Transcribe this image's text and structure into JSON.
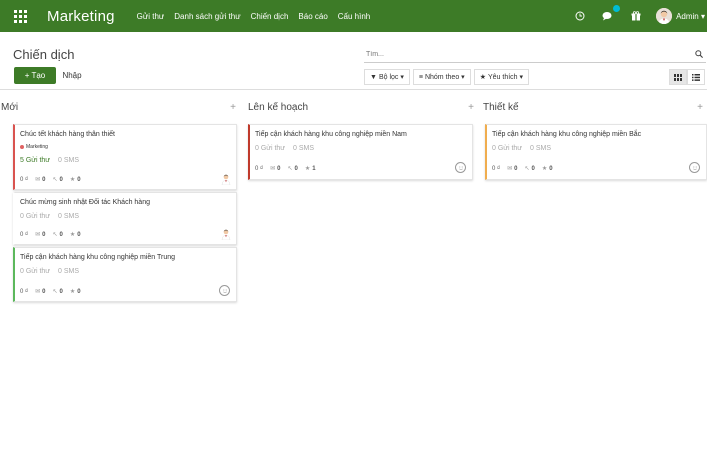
{
  "topbar": {
    "brand": "Marketing",
    "menu": [
      "Gửi thư",
      "Danh sách gửi thư",
      "Chiến dịch",
      "Báo cáo",
      "Cấu hình"
    ],
    "user": "Admin",
    "icons": [
      "apps-icon",
      "clock-icon",
      "chat-icon",
      "gift-icon",
      "avatar"
    ]
  },
  "control": {
    "title": "Chiến dịch",
    "create_label": "Tạo",
    "import_label": "Nhập",
    "search_placeholder": "Tìm...",
    "filter_label": "Bộ lọc",
    "group_label": "Nhóm theo",
    "favorite_label": "Yêu thích"
  },
  "columns": [
    {
      "title": "Mới",
      "cards": [
        {
          "name": "Chúc tết khách hàng thân thiết",
          "tag": "Marketing",
          "mail": "5 Gửi thư",
          "sms": "0 SMS",
          "revenue": "0 ₫",
          "opened": "0",
          "clicked": "0",
          "stars": "0",
          "accent": "#d9534f"
        },
        {
          "name": "Chúc mừng sinh nhật Đối tác Khách hàng",
          "mail": "0 Gửi thư",
          "sms": "0 SMS",
          "revenue": "0 ₫",
          "opened": "0",
          "clicked": "0",
          "stars": "0",
          "accent": "#ffffff"
        },
        {
          "name": "Tiếp cận khách hàng khu công nghiệp miền Trung",
          "mail": "0 Gửi thư",
          "sms": "0 SMS",
          "revenue": "0 ₫",
          "opened": "0",
          "clicked": "0",
          "stars": "0",
          "accent": "#5cb85c"
        }
      ]
    },
    {
      "title": "Lên kế hoạch",
      "cards": [
        {
          "name": "Tiếp cận khách hàng khu công nghiệp miền Nam",
          "mail": "0 Gửi thư",
          "sms": "0 SMS",
          "revenue": "0 ₫",
          "opened": "0",
          "clicked": "0",
          "stars": "1",
          "accent": "#c0392b"
        }
      ]
    },
    {
      "title": "Thiết kế",
      "cards": [
        {
          "name": "Tiếp cận khách hàng khu công nghiệp miền Bắc",
          "mail": "0 Gửi thư",
          "sms": "0 SMS",
          "revenue": "0 ₫",
          "opened": "0",
          "clicked": "0",
          "stars": "0",
          "accent": "#f0ad4e"
        }
      ]
    }
  ],
  "colors": {
    "brand": "#3d7b27",
    "topbar": "#3d7b27"
  }
}
